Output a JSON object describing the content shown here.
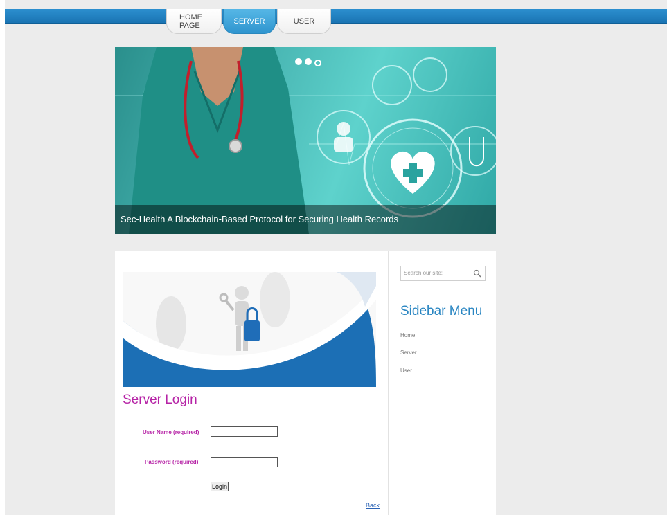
{
  "nav": {
    "tabs": [
      {
        "label": "HOME PAGE"
      },
      {
        "label": "SERVER",
        "active": true
      },
      {
        "label": "USER"
      }
    ]
  },
  "banner": {
    "caption": "Sec-Health A Blockchain-Based Protocol for Securing Health Records"
  },
  "login": {
    "title": "Server Login",
    "username_label": "User Name (required)",
    "username_value": "",
    "password_label": "Password (required)",
    "password_value": "",
    "button_label": "Login",
    "back_link": "Back"
  },
  "sidebar": {
    "search_placeholder": "Search our site:",
    "title": "Sidebar Menu",
    "items": [
      {
        "label": "Home"
      },
      {
        "label": "Server"
      },
      {
        "label": "User"
      }
    ]
  },
  "colors": {
    "accent": "#2a86c2",
    "login_title": "#b623a6",
    "nav_active": "#3ea3d8"
  }
}
